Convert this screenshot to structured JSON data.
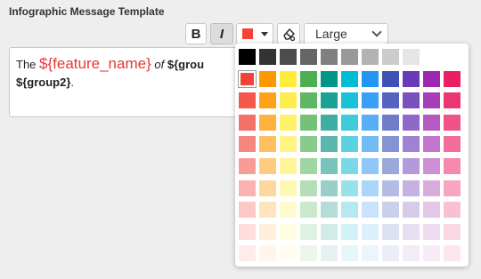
{
  "section_title": "Infographic Message Template",
  "toolbar": {
    "bold_label": "B",
    "italic_label": "I",
    "text_color": "#f44336",
    "font_size_value": "Large"
  },
  "editor": {
    "word_the": "The",
    "var_feature": "${feature_name}",
    "word_of": "of",
    "var_group_partial": "${grou",
    "var_group2": "${group2}",
    "trailing": "."
  },
  "palette": {
    "selected": "#f44336",
    "rows": [
      [
        "#000000",
        "#333333",
        "#4d4d4d",
        "#666666",
        "#808080",
        "#999999",
        "#b3b3b3",
        "#cccccc",
        "#e6e6e6",
        "#ffffff"
      ],
      [
        "#f44336",
        "#ff9800",
        "#ffeb3b",
        "#4caf50",
        "#009688",
        "#00bcd4",
        "#2196f3",
        "#3f51b5",
        "#673ab7",
        "#9c27b0",
        "#e91e63"
      ],
      [
        "#f5594d",
        "#ffa21a",
        "#ffed4e",
        "#5db861",
        "#1aa194",
        "#1ac2d8",
        "#37a0f4",
        "#5564c0",
        "#7a50bf",
        "#a83db9",
        "#ec3574"
      ],
      [
        "#f6706a",
        "#ffb140",
        "#fff06a",
        "#74c278",
        "#40ada3",
        "#40cbdd",
        "#57aef5",
        "#6f7cc9",
        "#8e69c9",
        "#b55ac3",
        "#ef5289"
      ],
      [
        "#f88680",
        "#ffbe5f",
        "#fff383",
        "#89cb8c",
        "#5cb7ae",
        "#5cd1e1",
        "#72bbf6",
        "#8593d2",
        "#a181d1",
        "#c275cc",
        "#f26d9b"
      ],
      [
        "#f99c97",
        "#ffcb80",
        "#fff59c",
        "#9fd5a1",
        "#7ac3bb",
        "#7ad9e6",
        "#8fc8f8",
        "#9ca7da",
        "#b39ada",
        "#ce90d5",
        "#f589ae"
      ],
      [
        "#fab3af",
        "#ffd8a0",
        "#fff8b5",
        "#b5deb7",
        "#98cfc9",
        "#98e1eb",
        "#acd6f9",
        "#b3bce2",
        "#c6b2e2",
        "#daacde",
        "#f7a5c1"
      ],
      [
        "#fcc8c5",
        "#ffe4bf",
        "#fffacd",
        "#cbe8cc",
        "#b5ddd8",
        "#b5e9f0",
        "#c8e3fb",
        "#c9d0ea",
        "#d8cbea",
        "#e5c7e7",
        "#f9c0d3"
      ],
      [
        "#fddedc",
        "#ffefdb",
        "#fffce1",
        "#dff1e0",
        "#d1ebe8",
        "#d1f2f6",
        "#ddeefc",
        "#dde1f2",
        "#e7def1",
        "#efdcf0",
        "#fbd6e3"
      ],
      [
        "#feeceb",
        "#fff5ea",
        "#fffdee",
        "#ecf7ec",
        "#e4f3f1",
        "#e4f8fa",
        "#ecf5fe",
        "#eceef7",
        "#f1ecf7",
        "#f6ecf7",
        "#fde7ef"
      ]
    ]
  },
  "icons": {
    "eraser": "format-clear-icon",
    "italic": "italic-icon",
    "bold": "bold-icon",
    "color_caret": "caret-down-icon",
    "size_caret": "chevron-down-icon"
  }
}
